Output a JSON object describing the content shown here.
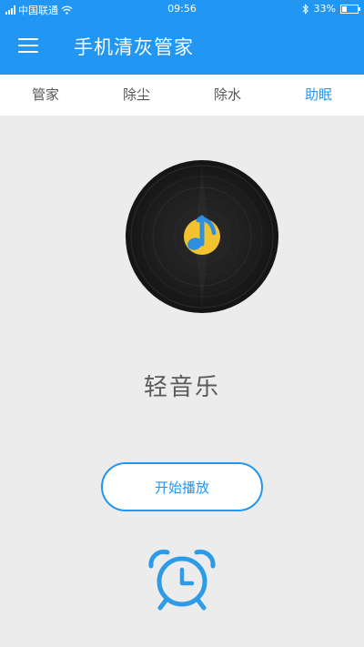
{
  "status_bar": {
    "carrier": "中国联通",
    "time": "09:56",
    "battery": "33%",
    "battery_level": 0.33,
    "icons": [
      "signal-icon",
      "wifi-icon",
      "bluetooth-icon",
      "battery-icon"
    ]
  },
  "app_bar": {
    "menu_icon": "hamburger-menu-icon",
    "title": "手机清灰管家"
  },
  "tabs": [
    {
      "label": "管家",
      "active": false
    },
    {
      "label": "除尘",
      "active": false
    },
    {
      "label": "除水",
      "active": false
    },
    {
      "label": "助眠",
      "active": true
    }
  ],
  "player": {
    "disc_icon": "vinyl-music-note-icon",
    "track_title": "轻音乐",
    "play_label": "开始播放",
    "alarm_icon": "alarm-clock-icon"
  },
  "colors": {
    "primary": "#2196f3",
    "background": "#ececec",
    "disc": "#1e1e1e",
    "note_circle": "#f2c32e"
  }
}
